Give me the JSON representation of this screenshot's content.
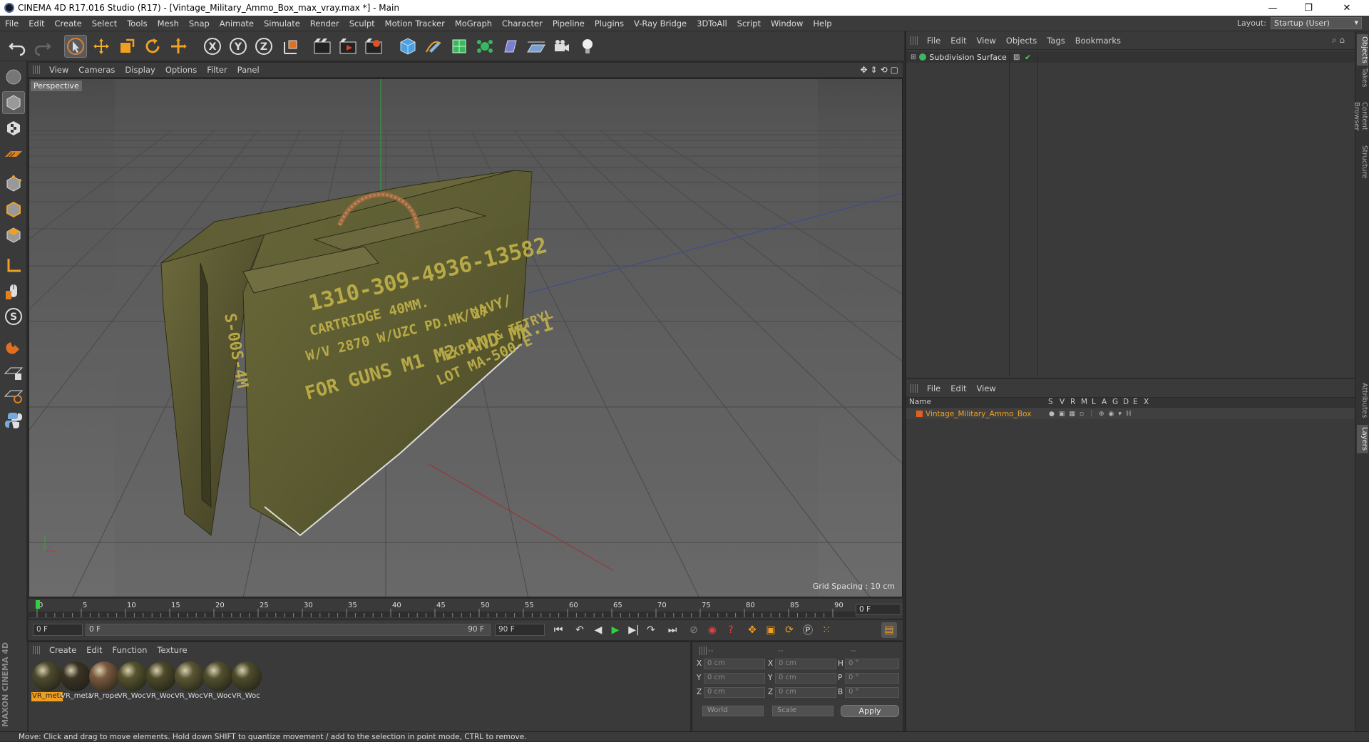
{
  "window": {
    "title": "CINEMA 4D R17.016 Studio (R17) - [Vintage_Military_Ammo_Box_max_vray.max *] - Main",
    "controls": {
      "minimize": "—",
      "restore": "❐",
      "close": "✕"
    }
  },
  "menubar": {
    "items": [
      "File",
      "Edit",
      "Create",
      "Select",
      "Tools",
      "Mesh",
      "Snap",
      "Animate",
      "Simulate",
      "Render",
      "Sculpt",
      "Motion Tracker",
      "MoGraph",
      "Character",
      "Pipeline",
      "Plugins",
      "V-Ray Bridge",
      "3DToAll",
      "Script",
      "Window",
      "Help"
    ],
    "layout_label": "Layout:",
    "layout_value": "Startup (User)"
  },
  "toolbar": {
    "icons": [
      "undo-icon",
      "redo-icon",
      "select-arrow-icon",
      "move-icon",
      "scale-icon",
      "rotate-icon",
      "move-axis-icon",
      "x-axis-icon",
      "y-axis-icon",
      "z-axis-icon",
      "coord-system-icon",
      "render-view-icon",
      "render-picture-viewer-icon",
      "edit-render-settings-icon",
      "cube-icon",
      "pen-icon",
      "subdivision-icon",
      "array-icon",
      "deformer-icon",
      "floor-icon",
      "camera-icon",
      "light-icon"
    ],
    "axis_labels": {
      "x": "X",
      "y": "Y",
      "z": "Z"
    }
  },
  "left_tools": [
    "make-editable-icon",
    "model-mode-icon",
    "texture-mode-icon",
    "workplane-icon",
    "points-mode-icon",
    "edges-mode-icon",
    "polygons-mode-icon",
    "axis-mode-icon",
    "tweak-icon",
    "snap-icon",
    "magnet-icon",
    "grid-lock-icon",
    "grid-icon",
    "python-icon"
  ],
  "viewport": {
    "menu": [
      "View",
      "Cameras",
      "Display",
      "Options",
      "Filter",
      "Panel"
    ],
    "label": "Perspective",
    "grid_spacing": "Grid Spacing : 10 cm",
    "box_text": {
      "line1": "1310-309-4936-13582",
      "line2": "CARTRIDGE 40MM.",
      "line3": "W/V 2870 W/UZC PD.MK 27",
      "line4": "FOR GUNS M1 M2 AND MK.1",
      "line5": "/NAVY/",
      "line6": "EXPL.O & TETRYL",
      "line7": "LOT MA-500-E",
      "side": "S-00S-4M"
    }
  },
  "timeline": {
    "ticks": [
      "0",
      "5",
      "10",
      "15",
      "20",
      "25",
      "30",
      "35",
      "40",
      "45",
      "50",
      "55",
      "60",
      "65",
      "70",
      "75",
      "80",
      "85",
      "90"
    ],
    "current_frame": "0 F"
  },
  "transport": {
    "start_field": "0 F",
    "range_start": "0 F",
    "range_end": "90 F",
    "end_field": "90 F"
  },
  "materials": {
    "menu": [
      "Create",
      "Edit",
      "Function",
      "Texture"
    ],
    "items": [
      {
        "label": "VR_meta",
        "color": "#4d4a2e",
        "selected": true
      },
      {
        "label": "VR_meta",
        "color": "#3a3326",
        "selected": false
      },
      {
        "label": "VR_rope",
        "color": "#7a5a40",
        "selected": false
      },
      {
        "label": "VR_Woc",
        "color": "#55532e",
        "selected": false
      },
      {
        "label": "VR_Woc",
        "color": "#4c4a2a",
        "selected": false
      },
      {
        "label": "VR_Woc",
        "color": "#5a5634",
        "selected": false
      },
      {
        "label": "VR_Woc",
        "color": "#525030",
        "selected": false
      },
      {
        "label": "VR_Woc",
        "color": "#4e4c2c",
        "selected": false
      }
    ]
  },
  "coordinates": {
    "header": [
      "--",
      "--",
      "--"
    ],
    "rows": [
      {
        "l1": "X",
        "v1": "0 cm",
        "l2": "X",
        "v2": "0 cm",
        "l3": "H",
        "v3": "0 °"
      },
      {
        "l1": "Y",
        "v1": "0 cm",
        "l2": "Y",
        "v2": "0 cm",
        "l3": "P",
        "v3": "0 °"
      },
      {
        "l1": "Z",
        "v1": "0 cm",
        "l2": "Z",
        "v2": "0 cm",
        "l3": "B",
        "v3": "0 °"
      }
    ],
    "space": "World",
    "mode": "Scale",
    "apply": "Apply"
  },
  "objects_panel": {
    "menu": [
      "File",
      "Edit",
      "View",
      "Objects",
      "Tags",
      "Bookmarks"
    ],
    "rows": [
      {
        "name": "Subdivision Surface"
      }
    ]
  },
  "layers_panel": {
    "menu": [
      "File",
      "Edit",
      "View"
    ],
    "columns": [
      "Name",
      "S",
      "V",
      "R",
      "M",
      "L",
      "A",
      "G",
      "D",
      "E",
      "X"
    ],
    "rows": [
      {
        "name": "Vintage_Military_Ammo_Box",
        "color": "#e06020"
      }
    ]
  },
  "right_tabs": [
    "Objects",
    "Takes",
    "Content Browser",
    "Structure",
    "Attributes",
    "Layers"
  ],
  "brand": {
    "logo_line1": "MAXON",
    "logo_line2": "CINEMA 4D"
  },
  "status": "Move: Click and drag to move elements. Hold down SHIFT to quantize movement / add to the selection in point mode, CTRL to remove."
}
